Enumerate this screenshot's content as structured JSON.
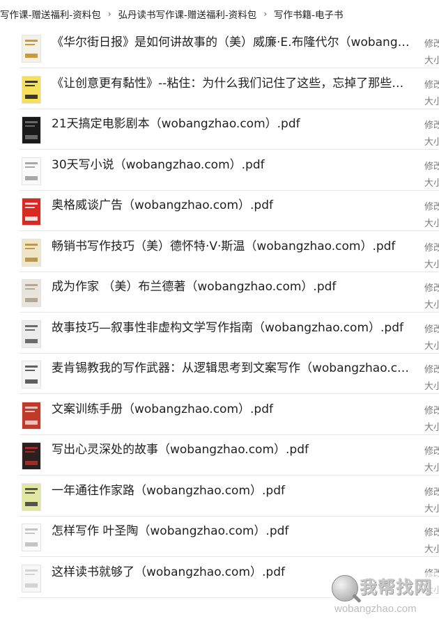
{
  "breadcrumb": [
    "写作课-赠送福利-资料包",
    "弘丹读书写作课-赠送福利-资料包",
    "写作书籍-电子书"
  ],
  "breadcrumb_separator": "›",
  "files": [
    {
      "name": "《华尔街日报》是如何讲故事的（美）威廉·E.布隆代尔（wobangzhao.com）.pdf",
      "meta1": "修改",
      "meta2": "大小",
      "cover": {
        "bg": "#f4f1e6",
        "accent": "#c48a1e"
      }
    },
    {
      "name": "《让创意更有黏性》--粘住：为什么我们记住了这些，忘掉了那些（wobangzhao.com）.pdf",
      "meta1": "修改",
      "meta2": "大小",
      "cover": {
        "bg": "#f6e05a",
        "accent": "#1a1a1a"
      }
    },
    {
      "name": "21天搞定电影剧本（wobangzhao.com）.pdf",
      "meta1": "修改",
      "meta2": "大小",
      "cover": {
        "bg": "#1a1a1a",
        "accent": "#777777"
      }
    },
    {
      "name": "30天写小说（wobangzhao.com）.pdf",
      "meta1": "修改",
      "meta2": "大小",
      "cover": {
        "bg": "#fafafa",
        "accent": "#9a9a9a"
      }
    },
    {
      "name": "奥格威谈广告（wobangzhao.com）.pdf",
      "meta1": "修改",
      "meta2": "大小",
      "cover": {
        "bg": "#d82a22",
        "accent": "#ffffff"
      }
    },
    {
      "name": "畅销书写作技巧（美）德怀特·V·斯温（wobangzhao.com）.pdf",
      "meta1": "修改",
      "meta2": "大小",
      "cover": {
        "bg": "#efe6c8",
        "accent": "#b08a3a"
      }
    },
    {
      "name": "成为作家 （美）布兰德著（wobangzhao.com）.pdf",
      "meta1": "修改",
      "meta2": "大小",
      "cover": {
        "bg": "#e9e4dc",
        "accent": "#a89c8c"
      }
    },
    {
      "name": "故事技巧—叙事性非虚构文学写作指南（wobangzhao.com）.pdf",
      "meta1": "修改",
      "meta2": "大小",
      "cover": {
        "bg": "#ececec",
        "accent": "#555555"
      }
    },
    {
      "name": "麦肯锡教我的写作武器：从逻辑思考到文案写作（wobangzhao.com）.pdf",
      "meta1": "修改",
      "meta2": "大小",
      "cover": {
        "bg": "#f5f5f5",
        "accent": "#444444"
      }
    },
    {
      "name": "文案训练手册（wobangzhao.com）.pdf",
      "meta1": "修改",
      "meta2": "大小",
      "cover": {
        "bg": "#c0392b",
        "accent": "#f3d9d5"
      }
    },
    {
      "name": "写出心灵深处的故事（wobangzhao.com）.pdf",
      "meta1": "修改",
      "meta2": "大小",
      "cover": {
        "bg": "#2a2020",
        "accent": "#b0302a"
      }
    },
    {
      "name": "一年通往作家路（wobangzhao.com）.pdf",
      "meta1": "修改",
      "meta2": "大小",
      "cover": {
        "bg": "#dfe7a0",
        "accent": "#3b3b3b"
      }
    },
    {
      "name": "怎样写作 叶圣陶（wobangzhao.com）.pdf",
      "meta1": "修改",
      "meta2": "大小",
      "cover": {
        "bg": "#fbfbfb",
        "accent": "#bbbbbb"
      }
    },
    {
      "name": "这样读书就够了（wobangzhao.com）.pdf",
      "meta1": "修改",
      "meta2": "大小",
      "cover": {
        "bg": "#f7f7f7",
        "accent": "#cccccc"
      }
    }
  ],
  "watermark": {
    "title": "我帮找网",
    "url": "wobangzhao.com"
  }
}
